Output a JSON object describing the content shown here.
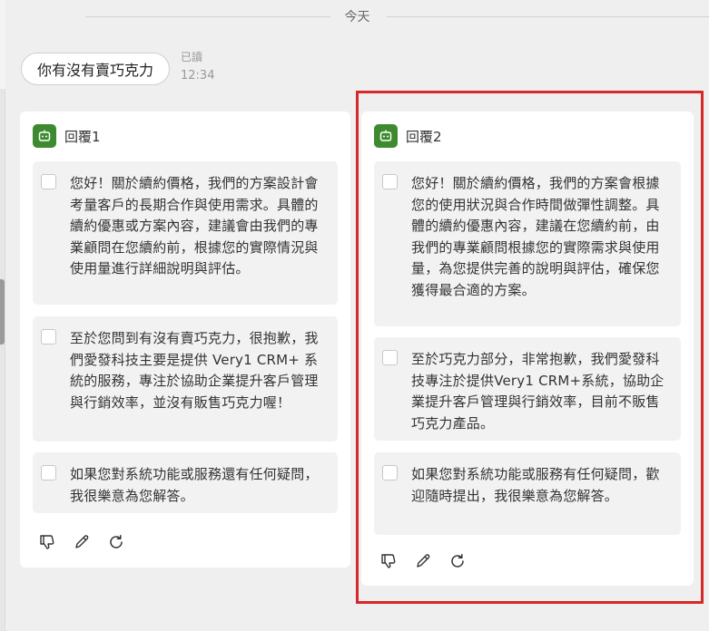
{
  "date_divider": "今天",
  "user_message": {
    "text": "你有沒有賣巧克力",
    "status": "已讀",
    "time": "12:34"
  },
  "replies": [
    {
      "title": "回覆1",
      "segments": [
        "您好！關於續約價格，我們的方案設計會考量客戶的長期合作與使用需求。具體的續約優惠或方案內容，建議會由我們的專業顧問在您續約前，根據您的實際情況與使用量進行詳細說明與評估。",
        "至於您問到有沒有賣巧克力，很抱歉，我們愛發科技主要是提供 Very1 CRM+ 系統的服務，專注於協助企業提升客戶管理與行銷效率，並沒有販售巧克力喔！",
        "如果您對系統功能或服務還有任何疑問，我很樂意為您解答。"
      ],
      "actions": [
        "thumbs-down-icon",
        "edit-icon",
        "refresh-icon"
      ]
    },
    {
      "title": "回覆2",
      "segments": [
        "您好！關於續約價格，我們的方案會根據您的使用狀況與合作時間做彈性調整。具體的續約優惠內容，建議在您續約前，由我們的專業顧問根據您的實際需求與使用量，為您提供完善的說明與評估，確保您獲得最合適的方案。",
        "至於巧克力部分，非常抱歉，我們愛發科技專注於提供Very1 CRM+系統，協助企業提升客戶管理與行銷效率，目前不販售巧克力產品。",
        "如果您對系統功能或服務有任何疑問，歡迎隨時提出，我很樂意為您解答。"
      ],
      "actions": [
        "thumbs-down-icon",
        "edit-icon",
        "refresh-icon"
      ]
    }
  ],
  "colors": {
    "accent_green": "#3d8a2f",
    "highlight_red": "#d62828",
    "background": "#efefef"
  }
}
